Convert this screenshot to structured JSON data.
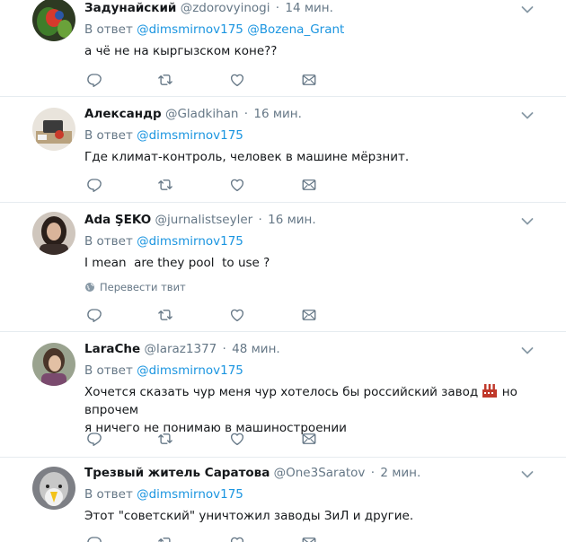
{
  "reply_prefix": "В ответ",
  "translate_label": "Перевести твит",
  "tweets": [
    {
      "name": "Задунайский",
      "handle": "@zdorovyinogi",
      "time": "14 мин.",
      "mentions": [
        "@dimsmirnov175",
        "@Bozena_Grant"
      ],
      "text": "а чё не на кыргызском коне??"
    },
    {
      "name": "Александр",
      "handle": "@Gladkihan",
      "time": "16 мин.",
      "mentions": [
        "@dimsmirnov175"
      ],
      "text": "Где климат-контроль, человек в машине мёрзнит."
    },
    {
      "name": "Ada ŞEKO",
      "handle": "@jurnalistseyler",
      "time": "16 мин.",
      "mentions": [
        "@dimsmirnov175"
      ],
      "text": "I mean  are they pool  to use ?"
    },
    {
      "name": "LaraChe",
      "handle": "@laraz1377",
      "time": "48 мин.",
      "mentions": [
        "@dimsmirnov175"
      ],
      "text_line1": "Хочется сказать чур меня чур хотелось бы российский завод",
      "text_line1_after": "но впрочем",
      "text_line2": "я ничего не понимаю в машиностроении",
      "emoji": "factory-emoji"
    },
    {
      "name": "Трезвый житель Саратова",
      "handle": "@One3Saratov",
      "time": "2 мин.",
      "mentions": [
        "@dimsmirnov175"
      ],
      "text": "Этот \"советский\" уничтожил заводы ЗиЛ и другие."
    }
  ],
  "icons": {
    "reply": "reply-icon",
    "retweet": "retweet-icon",
    "like": "heart-icon",
    "message": "envelope-icon",
    "more": "chevron-down-icon",
    "translate": "globe-icon"
  },
  "colors": {
    "link": "#1b95e0",
    "muted": "#657786",
    "icon": "#657786",
    "divider": "#e6ecf0"
  }
}
